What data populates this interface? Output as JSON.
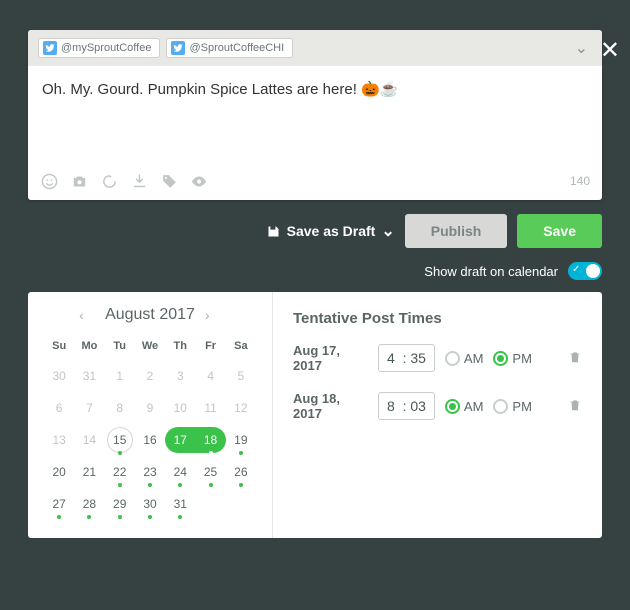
{
  "accounts": [
    {
      "handle": "@mySproutCoffee"
    },
    {
      "handle": "@SproutCoffeeCHI"
    }
  ],
  "compose": {
    "text": "Oh. My. Gourd. Pumpkin Spice Lattes are here! 🎃☕",
    "char_count": "140"
  },
  "actions": {
    "save_draft": "Save as Draft",
    "publish": "Publish",
    "save": "Save"
  },
  "toggle": {
    "label": "Show draft on calendar",
    "on": true
  },
  "calendar": {
    "title": "August 2017",
    "dow": [
      "Su",
      "Mo",
      "Tu",
      "We",
      "Th",
      "Fr",
      "Sa"
    ],
    "cells": [
      {
        "n": "30",
        "muted": true
      },
      {
        "n": "31",
        "muted": true
      },
      {
        "n": "1",
        "muted": true
      },
      {
        "n": "2",
        "muted": true
      },
      {
        "n": "3",
        "muted": true
      },
      {
        "n": "4",
        "muted": true
      },
      {
        "n": "5",
        "muted": true
      },
      {
        "n": "6",
        "muted": true
      },
      {
        "n": "7",
        "muted": true
      },
      {
        "n": "8",
        "muted": true
      },
      {
        "n": "9",
        "muted": true
      },
      {
        "n": "10",
        "muted": true
      },
      {
        "n": "11",
        "muted": true
      },
      {
        "n": "12",
        "muted": true
      },
      {
        "n": "13",
        "muted": true
      },
      {
        "n": "14",
        "muted": true
      },
      {
        "n": "15",
        "outline": true,
        "dot": true
      },
      {
        "n": "16"
      },
      {
        "n": "17",
        "sel": "left"
      },
      {
        "n": "18",
        "sel": "right",
        "dotw": true
      },
      {
        "n": "19",
        "dot": true
      },
      {
        "n": "20"
      },
      {
        "n": "21"
      },
      {
        "n": "22",
        "dot": true
      },
      {
        "n": "23",
        "dot": true
      },
      {
        "n": "24",
        "dot": true
      },
      {
        "n": "25",
        "dot": true
      },
      {
        "n": "26",
        "dot": true
      },
      {
        "n": "27",
        "dot": true
      },
      {
        "n": "28",
        "dot": true
      },
      {
        "n": "29",
        "dot": true
      },
      {
        "n": "30",
        "dot": true
      },
      {
        "n": "31",
        "dot": true
      },
      {
        "n": "",
        "muted": true
      },
      {
        "n": "",
        "muted": true
      }
    ]
  },
  "times": {
    "title": "Tentative Post Times",
    "rows": [
      {
        "date": "Aug 17, 2017",
        "h": "4",
        "m": "35",
        "ampm": "PM"
      },
      {
        "date": "Aug 18, 2017",
        "h": "8",
        "m": "03",
        "ampm": "AM"
      }
    ],
    "am_label": "AM",
    "pm_label": "PM"
  }
}
